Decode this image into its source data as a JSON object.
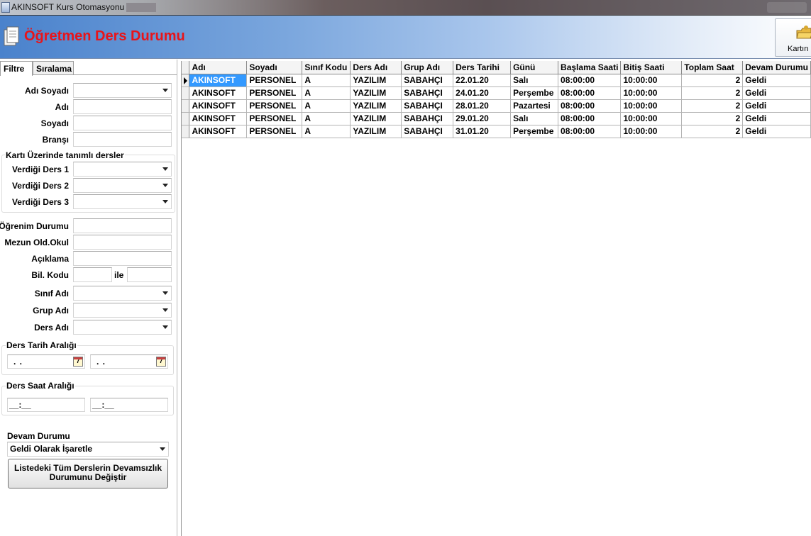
{
  "window": {
    "title": "AKINSOFT Kurs Otomasyonu s"
  },
  "header": {
    "title": "Öğretmen Ders Durumu",
    "card_button_label": "Kartın"
  },
  "tabs": [
    {
      "label": "Filtre",
      "active": true
    },
    {
      "label": "Sıralama",
      "active": false
    }
  ],
  "filter": {
    "adi_soyadi_label": "Adı Soyadı",
    "adi_label": "Adı",
    "soyadi_label": "Soyadı",
    "bransi_label": "Branşı",
    "kart_group_title": "Kartı Üzerinde tanımlı dersler",
    "verdigi_ders_1_label": "Verdiği Ders 1",
    "verdigi_ders_2_label": "Verdiği Ders 2",
    "verdigi_ders_3_label": "Verdiği Ders 3",
    "ogrenim_durumu_label": "Öğrenim Durumu",
    "mezun_okul_label": "Mezun Old.Okul",
    "aciklama_label": "Açıklama",
    "bil_kodu_label": "Bil. Kodu",
    "ile_label": "ile",
    "sinif_adi_label": "Sınıf Adı",
    "grup_adi_label": "Grup Adı",
    "ders_adi_label": "Ders Adı",
    "ders_tarih_title": "Ders Tarih Aralığı",
    "date_placeholder": ". .",
    "ders_saat_title": "Ders Saat Aralığı",
    "time_placeholder": "__:__",
    "devam_durumu_label": "Devam Durumu",
    "devam_durumu_value": "Geldi Olarak İşaretle",
    "action_button_label": "Listedeki Tüm Derslerin Devamsızlık Durumunu Değiştir",
    "calendar_icon_text": "7"
  },
  "grid": {
    "columns": [
      "Adı",
      "Soyadı",
      "Sınıf Kodu",
      "Ders Adı",
      "Grup Adı",
      "Ders Tarihi",
      "Günü",
      "Başlama Saati",
      "Bitiş Saati",
      "Toplam Saat",
      "Devam Durumu"
    ],
    "rows": [
      [
        "AKINSOFT",
        "PERSONEL",
        "A",
        "YAZILIM",
        "SABAHÇI",
        "22.01.20",
        "Salı",
        "08:00:00",
        "10:00:00",
        "2",
        "Geldi"
      ],
      [
        "AKINSOFT",
        "PERSONEL",
        "A",
        "YAZILIM",
        "SABAHÇI",
        "24.01.20",
        "Perşembe",
        "08:00:00",
        "10:00:00",
        "2",
        "Geldi"
      ],
      [
        "AKINSOFT",
        "PERSONEL",
        "A",
        "YAZILIM",
        "SABAHÇI",
        "28.01.20",
        "Pazartesi",
        "08:00:00",
        "10:00:00",
        "2",
        "Geldi"
      ],
      [
        "AKINSOFT",
        "PERSONEL",
        "A",
        "YAZILIM",
        "SABAHÇI",
        "29.01.20",
        "Salı",
        "08:00:00",
        "10:00:00",
        "2",
        "Geldi"
      ],
      [
        "AKINSOFT",
        "PERSONEL",
        "A",
        "YAZILIM",
        "SABAHÇI",
        "31.01.20",
        "Perşembe",
        "08:00:00",
        "10:00:00",
        "2",
        "Geldi"
      ]
    ],
    "selected_row": 0
  },
  "colors": {
    "title_red": "#e8141a",
    "selection_blue": "#3399ff",
    "banner_blue": "#4a82cc"
  }
}
